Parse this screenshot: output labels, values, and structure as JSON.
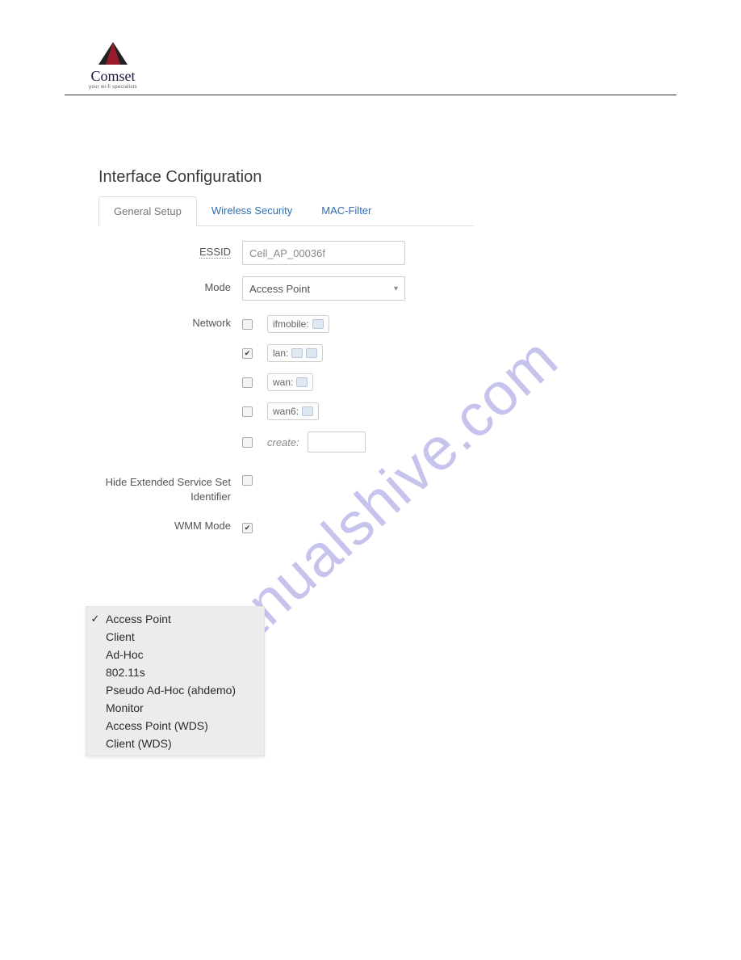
{
  "brand": {
    "name": "Comset",
    "tagline": "your wi-fi specialists"
  },
  "watermark": "manualshive.com",
  "form": {
    "title": "Interface Configuration",
    "tabs": {
      "general": "General Setup",
      "security": "Wireless Security",
      "macfilter": "MAC-Filter"
    },
    "labels": {
      "essid": "ESSID",
      "mode": "Mode",
      "network": "Network",
      "hide_essid_l1": "Hide Extended Service Set",
      "hide_essid_l2": "Identifier",
      "wmm": "WMM Mode",
      "create": "create:"
    },
    "values": {
      "essid": "Cell_AP_00036f",
      "mode": "Access Point",
      "wmm_checked": "✔",
      "hide_checked": ""
    },
    "net": {
      "ifmobile": {
        "label": "ifmobile:",
        "checked": ""
      },
      "lan": {
        "label": "lan:",
        "checked": "✔"
      },
      "wan": {
        "label": "wan:",
        "checked": ""
      },
      "wan6": {
        "label": "wan6:",
        "checked": ""
      },
      "create": {
        "checked": ""
      }
    }
  },
  "mode_options": {
    "o0": "Access Point",
    "o1": "Client",
    "o2": "Ad-Hoc",
    "o3": "802.11s",
    "o4": "Pseudo Ad-Hoc (ahdemo)",
    "o5": "Monitor",
    "o6": "Access Point (WDS)",
    "o7": "Client (WDS)",
    "selected_mark": "✓"
  }
}
